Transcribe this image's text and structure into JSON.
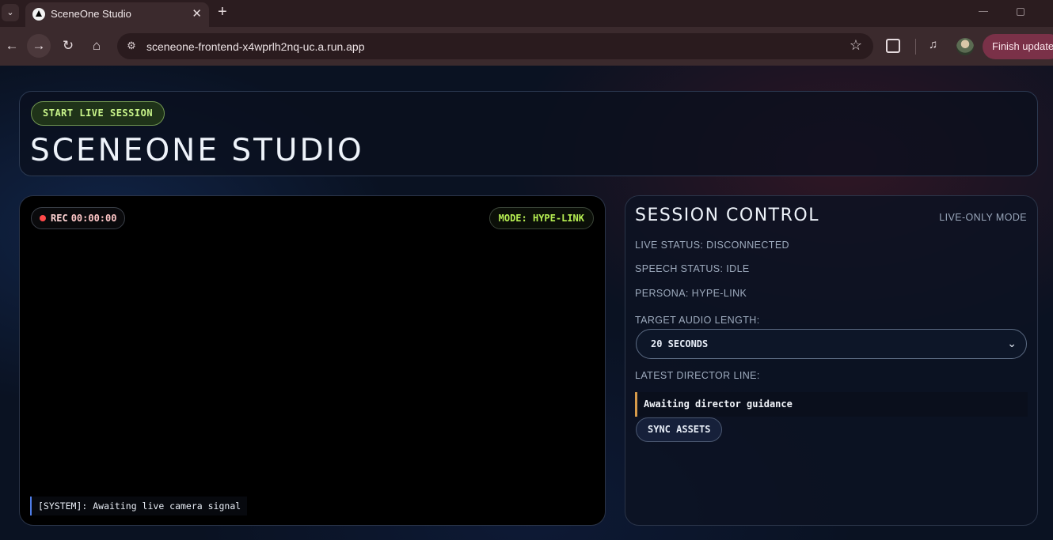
{
  "browser": {
    "tab_menu_icon": "chevron-down-icon",
    "tab_title": "SceneOne Studio",
    "tab_close": "✕",
    "new_tab": "+",
    "url": "sceneone-frontend-x4wprlh2nq-uc.a.run.app",
    "update_label": "Finish update",
    "icons": [
      "back-icon",
      "forward-icon",
      "reload-icon",
      "home-icon",
      "site-info-icon",
      "bookmark-star-icon",
      "extensions-icon",
      "media-control-icon",
      "profile-avatar"
    ]
  },
  "header": {
    "start_button": "START LIVE SESSION",
    "title": "SCENEONE STUDIO"
  },
  "stage": {
    "rec_label": "REC",
    "rec_time": "00:00:00",
    "mode": "MODE: HYPE-LINK",
    "system_log": "[SYSTEM]: Awaiting live camera signal"
  },
  "panel": {
    "title": "SESSION CONTROL",
    "mode_tag": "LIVE-ONLY MODE",
    "live_status": "LIVE STATUS: DISCONNECTED",
    "speech_status": "SPEECH STATUS: IDLE",
    "persona": "PERSONA: HYPE-LINK",
    "audio_length_label": "TARGET AUDIO LENGTH:",
    "audio_length_value": "20 SECONDS",
    "director_label": "LATEST DIRECTOR LINE:",
    "director_line": "Awaiting director guidance",
    "sync_button": "SYNC ASSETS"
  },
  "colors": {
    "accent_green": "#b6ee52",
    "rec_red": "#ff4a4a",
    "director_bar": "#d69a4a",
    "system_bar": "#4f7de8",
    "update_button": "#7a3148"
  }
}
